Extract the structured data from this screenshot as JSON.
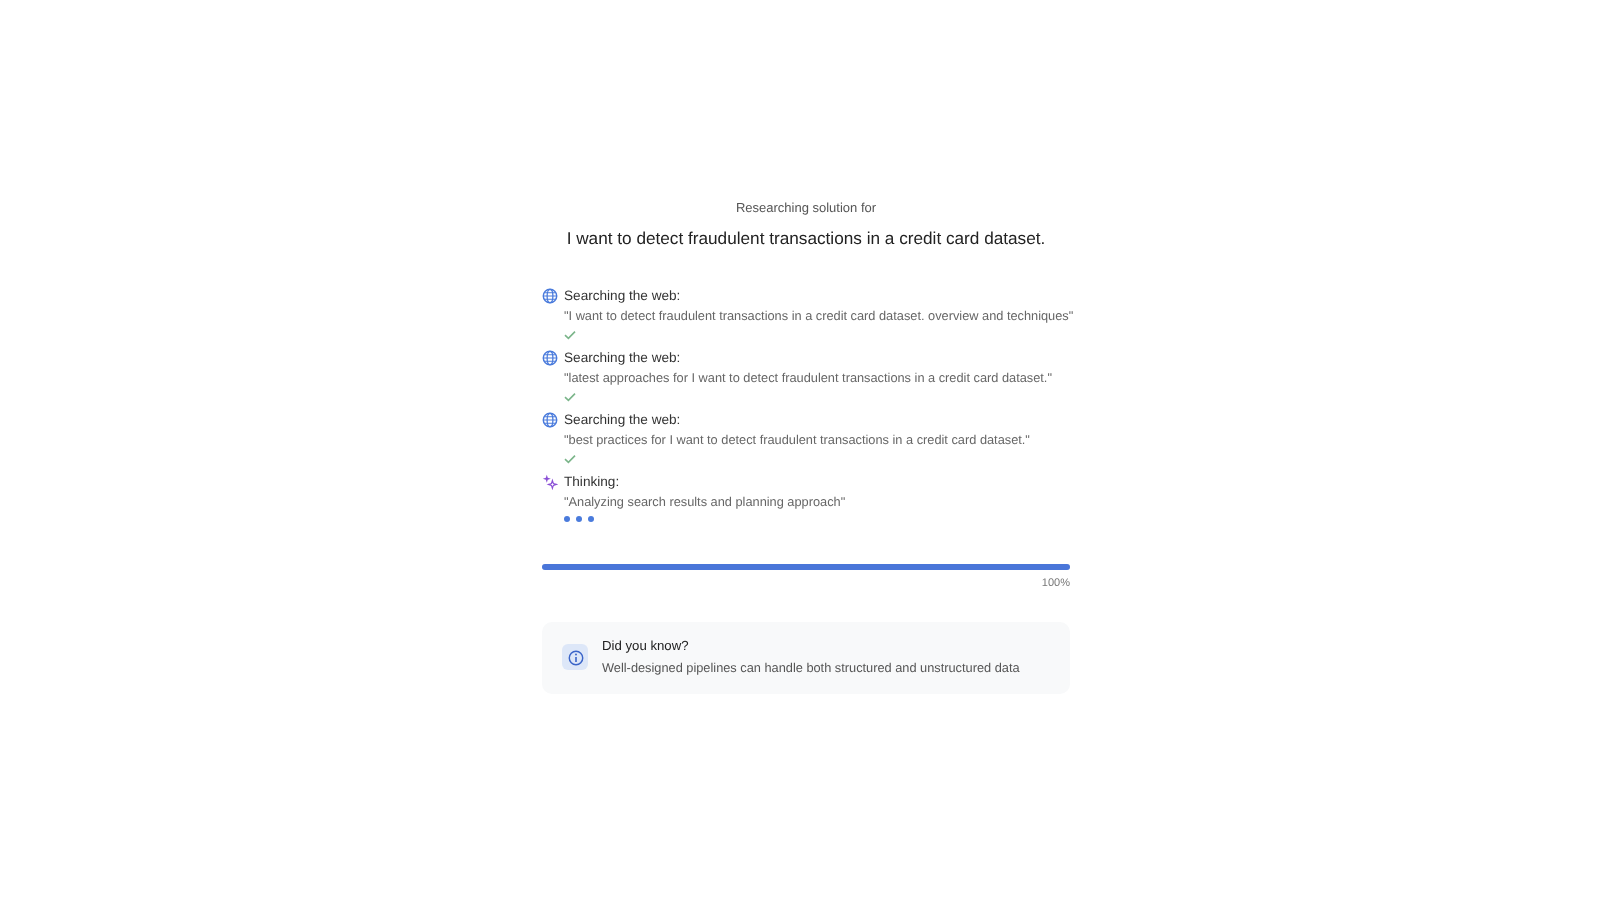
{
  "header": {
    "subtitle": "Researching solution for",
    "query": "I want to detect fraudulent transactions in a credit card dataset."
  },
  "steps": [
    {
      "kind": "web",
      "label": "Searching the web:",
      "detail": "\"I want to detect fraudulent transactions in a credit card dataset. overview and techniques\"",
      "done": true
    },
    {
      "kind": "web",
      "label": "Searching the web:",
      "detail": "\"latest approaches for I want to detect fraudulent transactions in a credit card dataset.\"",
      "done": true
    },
    {
      "kind": "web",
      "label": "Searching the web:",
      "detail": "\"best practices for I want to detect fraudulent transactions in a credit card dataset.\"",
      "done": true
    },
    {
      "kind": "thinking",
      "label": "Thinking:",
      "detail": "\"Analyzing search results and planning approach\"",
      "done": false
    }
  ],
  "progress": {
    "level": 1,
    "reading": "100%"
  },
  "tip": {
    "title": "Did you know?",
    "text": "Well-designed pipelines can handle both structured and unstructured data"
  }
}
